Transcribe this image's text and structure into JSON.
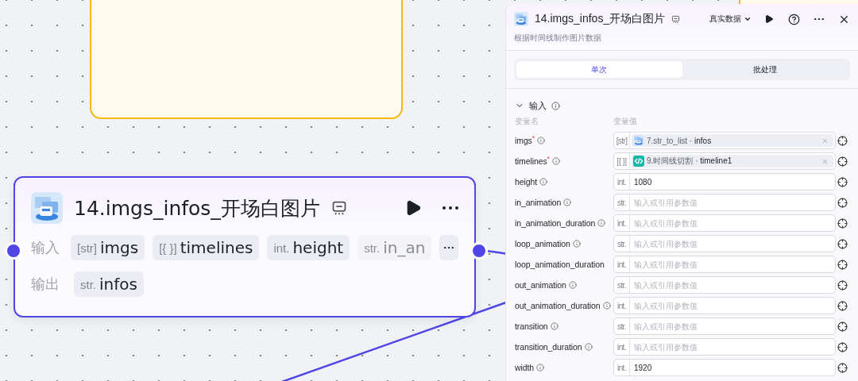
{
  "node": {
    "title": "14.imgs_infos_开场白图片",
    "inputs_label": "输入",
    "inputs": [
      {
        "type": "[str]",
        "name": "imgs",
        "faded": false
      },
      {
        "type": "[{ }]",
        "name": "timelines",
        "faded": false
      },
      {
        "type": "int.",
        "name": "height",
        "faded": false
      },
      {
        "type": "str.",
        "name": "in_an",
        "faded": true
      }
    ],
    "outputs_label": "输出",
    "outputs": [
      {
        "type": "str.",
        "name": "infos",
        "faded": false
      }
    ]
  },
  "panel": {
    "title": "14.imgs_infos_开场白图片",
    "subtitle": "根据时间线制作图片数据",
    "data_mode": "真实数据",
    "tabs": [
      {
        "label": "单次",
        "selected": true
      },
      {
        "label": "批处理",
        "selected": false
      }
    ],
    "section": {
      "title": "输入",
      "expanded": true,
      "columns": [
        "变量名",
        "变量值"
      ],
      "params": [
        {
          "name": "imgs",
          "required_mark": "*",
          "info": true,
          "type": "[str]",
          "kind": "reference",
          "reference": {
            "kind": "image",
            "node": "7.str_to_list",
            "separator": "·",
            "output": "infos"
          }
        },
        {
          "name": "timelines",
          "required_mark": "*",
          "info": true,
          "type": "[{ }]",
          "kind": "reference",
          "reference": {
            "kind": "code",
            "node": "9.时间线切割",
            "separator": "·",
            "output": "timeline1"
          }
        },
        {
          "name": "height",
          "info": true,
          "type": "int.",
          "kind": "value",
          "value": "1080"
        },
        {
          "name": "in_animation",
          "info": true,
          "type": "str.",
          "kind": "empty",
          "placeholder": "输入或引用参数值"
        },
        {
          "name": "in_animation_duration",
          "info": true,
          "type": "int.",
          "kind": "empty",
          "placeholder": "输入或引用参数值"
        },
        {
          "name": "loop_animation",
          "info": true,
          "type": "str.",
          "kind": "empty",
          "placeholder": "输入或引用参数值"
        },
        {
          "name": "loop_animation_duration",
          "info": false,
          "type": "int.",
          "kind": "empty",
          "placeholder": "输入或引用参数值"
        },
        {
          "name": "out_animation",
          "info": true,
          "type": "str.",
          "kind": "empty",
          "placeholder": "输入或引用参数值"
        },
        {
          "name": "out_animation_duration",
          "info": true,
          "type": "int.",
          "kind": "empty",
          "placeholder": "输入或引用参数值"
        },
        {
          "name": "transition",
          "info": true,
          "type": "str.",
          "kind": "empty",
          "placeholder": "输入或引用参数值"
        },
        {
          "name": "transition_duration",
          "info": true,
          "type": "int.",
          "kind": "empty",
          "placeholder": "输入或引用参数值"
        },
        {
          "name": "width",
          "info": true,
          "type": "int.",
          "kind": "value",
          "value": "1920"
        }
      ]
    }
  }
}
